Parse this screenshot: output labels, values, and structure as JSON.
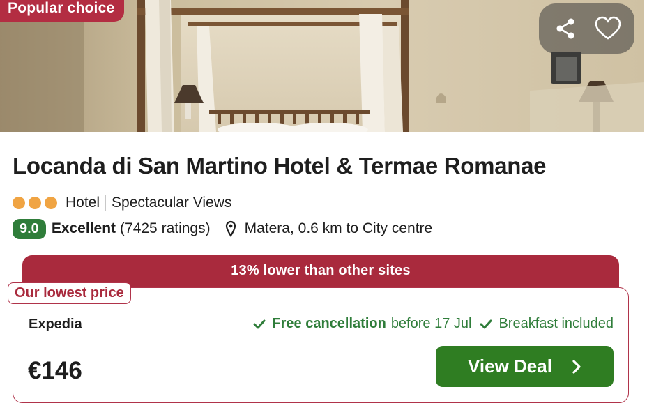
{
  "hero": {
    "badge": "Popular choice",
    "actions": {
      "share_icon": "share-icon",
      "favorite_icon": "heart-icon"
    }
  },
  "hotel": {
    "name": "Locanda di San Martino Hotel & Termae Romanae",
    "star_rating": 3,
    "type": "Hotel",
    "feature": "Spectacular Views",
    "score": "9.0",
    "rating_label": "Excellent",
    "ratings_count": "(7425 ratings)",
    "location": "Matera, 0.6 km to City centre"
  },
  "deal": {
    "banner": "13% lower than other sites",
    "tag": "Our lowest price",
    "provider": "Expedia",
    "perks": {
      "cancellation_strong": "Free cancellation",
      "cancellation_rest": "before 17 Jul",
      "breakfast": "Breakfast included"
    },
    "price": "€146",
    "cta": "View Deal"
  },
  "colors": {
    "brand_red": "#a92a3d",
    "rating_green": "#2f7d3a",
    "cta_green": "#2f7d22",
    "star_orange": "#f0a443"
  }
}
